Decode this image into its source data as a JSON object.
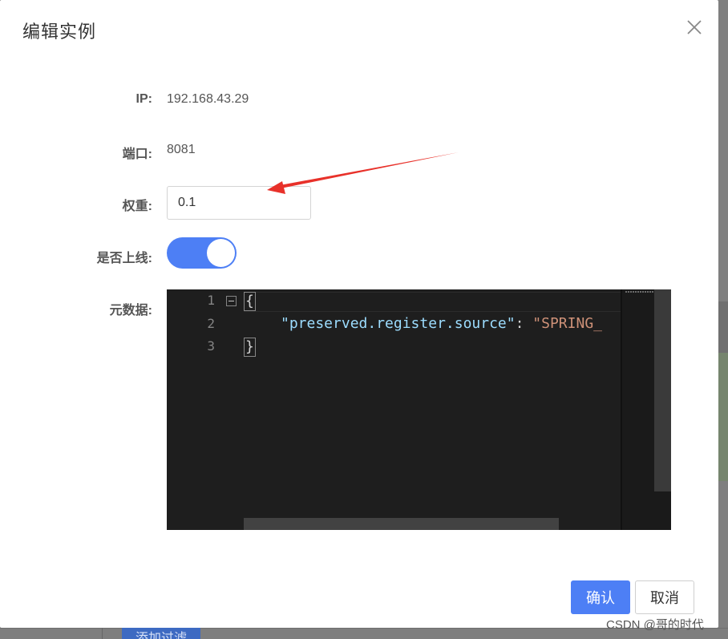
{
  "dialog": {
    "title": "编辑实例",
    "close_icon": "close-icon"
  },
  "form": {
    "ip_label": "IP:",
    "ip_value": "192.168.43.29",
    "port_label": "端口:",
    "port_value": "8081",
    "weight_label": "权重:",
    "weight_value": "0.1",
    "online_label": "是否上线:",
    "online_enabled": true,
    "metadata_label": "元数据:"
  },
  "editor": {
    "line_numbers": [
      "1",
      "2",
      "3"
    ],
    "lines": {
      "open_brace": "{",
      "key": "\"preserved.register.source\"",
      "colon": ": ",
      "value": "\"SPRING_",
      "close_brace": "}"
    }
  },
  "buttons": {
    "confirm": "确认",
    "cancel": "取消"
  },
  "background": {
    "filter_button": "添加过滤"
  },
  "watermark": "CSDN @哥的时代",
  "colors": {
    "primary": "#4d7ff5",
    "editor_bg": "#1e1e1e",
    "annotation_arrow": "#e8312a"
  }
}
